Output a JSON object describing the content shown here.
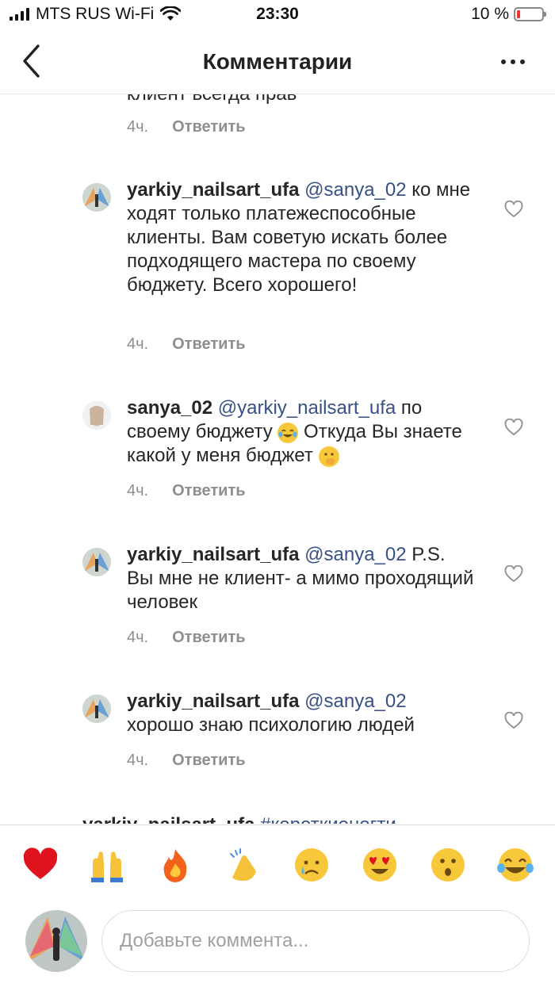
{
  "status_bar": {
    "carrier": "MTS RUS Wi-Fi",
    "time": "23:30",
    "battery": "10 %"
  },
  "header": {
    "title": "Комментарии",
    "back_icon": "chevron-left-icon",
    "more_icon": "more-horizontal-icon"
  },
  "previous_comment": {
    "partial_text": "клиент всегда прав",
    "time": "4ч.",
    "reply_label": "Ответить"
  },
  "comments": [
    {
      "username": "yarkiy_nailsart_ufa",
      "mention": "@sanya_02",
      "text": " ко мне ходят только платежеспособные клиенты. Вам советую искать более подходящего мастера по своему бюджету. Всего хорошего!",
      "time": "4ч.",
      "reply_label": "Ответить"
    },
    {
      "username": "sanya_02",
      "mention": "@yarkiy_nailsart_ufa",
      "text_a": " по своему бюджету ",
      "emoji_a": "face-with-tears-of-joy-emoji",
      "text_b": " Откуда Вы знаете какой у меня бюджет ",
      "emoji_b": "face-with-hand-over-mouth-emoji",
      "time": "4ч.",
      "reply_label": "Ответить"
    },
    {
      "username": "yarkiy_nailsart_ufa",
      "mention": "@sanya_02",
      "text": " P.S. Вы мне не клиент- а мимо проходящий человек",
      "time": "4ч.",
      "reply_label": "Ответить"
    },
    {
      "username": "yarkiy_nailsart_ufa",
      "mention": "@sanya_02",
      "text": " хорошо знаю психологию людей",
      "time": "4ч.",
      "reply_label": "Ответить"
    }
  ],
  "next_comment_peek": {
    "username": "yarkiy_nailsart_ufa",
    "mention": "#короткиеногти"
  },
  "emoji_bar": [
    "red-heart",
    "raising-hands",
    "fire",
    "clapping-hands",
    "crying-face",
    "heart-eyes",
    "astonished-face",
    "tears-of-joy"
  ],
  "composer": {
    "placeholder": "Добавьте коммента..."
  },
  "colors": {
    "mention": "#385185",
    "muted": "#8e8e8e",
    "text": "#262626"
  }
}
